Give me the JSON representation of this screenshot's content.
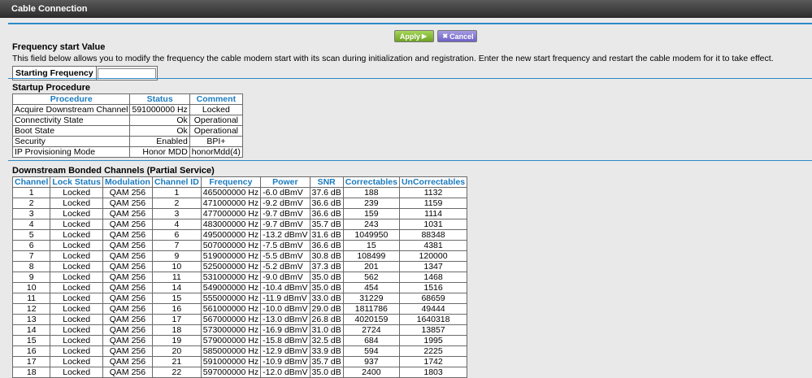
{
  "window": {
    "title": "Cable Connection"
  },
  "buttons": {
    "apply": "Apply",
    "cancel": "Cancel"
  },
  "frequency": {
    "title": "Frequency start Value",
    "description": "This field below allows you to modify the frequency the cable modem start with its scan during initialization and registration. Enter the new start frequency and restart the cable modem for it to take effect.",
    "label": "Starting Frequency",
    "value": ""
  },
  "startup": {
    "title": "Startup Procedure",
    "headers": [
      "Procedure",
      "Status",
      "Comment"
    ],
    "rows": [
      [
        "Acquire Downstream Channel",
        "591000000 Hz",
        "Locked"
      ],
      [
        "Connectivity State",
        "Ok",
        "Operational"
      ],
      [
        "Boot State",
        "Ok",
        "Operational"
      ],
      [
        "Security",
        "Enabled",
        "BPI+"
      ],
      [
        "IP Provisioning Mode",
        "Honor MDD",
        "honorMdd(4)"
      ]
    ]
  },
  "downstream": {
    "title": "Downstream Bonded Channels (Partial Service)",
    "headers": [
      "Channel",
      "Lock Status",
      "Modulation",
      "Channel ID",
      "Frequency",
      "Power",
      "SNR",
      "Correctables",
      "UnCorrectables"
    ],
    "rows": [
      [
        "1",
        "Locked",
        "QAM 256",
        "1",
        "465000000 Hz",
        "-6.0 dBmV",
        "37.6 dB",
        "188",
        "1132"
      ],
      [
        "2",
        "Locked",
        "QAM 256",
        "2",
        "471000000 Hz",
        "-9.2 dBmV",
        "36.6 dB",
        "239",
        "1159"
      ],
      [
        "3",
        "Locked",
        "QAM 256",
        "3",
        "477000000 Hz",
        "-9.7 dBmV",
        "36.6 dB",
        "159",
        "1114"
      ],
      [
        "4",
        "Locked",
        "QAM 256",
        "4",
        "483000000 Hz",
        "-9.7 dBmV",
        "35.7 dB",
        "243",
        "1031"
      ],
      [
        "5",
        "Locked",
        "QAM 256",
        "6",
        "495000000 Hz",
        "-13.2 dBmV",
        "31.6 dB",
        "1049950",
        "88348"
      ],
      [
        "6",
        "Locked",
        "QAM 256",
        "7",
        "507000000 Hz",
        "-7.5 dBmV",
        "36.6 dB",
        "15",
        "4381"
      ],
      [
        "7",
        "Locked",
        "QAM 256",
        "9",
        "519000000 Hz",
        "-5.5 dBmV",
        "30.8 dB",
        "108499",
        "120000"
      ],
      [
        "8",
        "Locked",
        "QAM 256",
        "10",
        "525000000 Hz",
        "-5.2 dBmV",
        "37.3 dB",
        "201",
        "1347"
      ],
      [
        "9",
        "Locked",
        "QAM 256",
        "11",
        "531000000 Hz",
        "-9.0 dBmV",
        "35.0 dB",
        "562",
        "1468"
      ],
      [
        "10",
        "Locked",
        "QAM 256",
        "14",
        "549000000 Hz",
        "-10.4 dBmV",
        "35.0 dB",
        "454",
        "1516"
      ],
      [
        "11",
        "Locked",
        "QAM 256",
        "15",
        "555000000 Hz",
        "-11.9 dBmV",
        "33.0 dB",
        "31229",
        "68659"
      ],
      [
        "12",
        "Locked",
        "QAM 256",
        "16",
        "561000000 Hz",
        "-10.0 dBmV",
        "29.0 dB",
        "1811786",
        "49444"
      ],
      [
        "13",
        "Locked",
        "QAM 256",
        "17",
        "567000000 Hz",
        "-13.0 dBmV",
        "26.8 dB",
        "4020159",
        "1640318"
      ],
      [
        "14",
        "Locked",
        "QAM 256",
        "18",
        "573000000 Hz",
        "-16.9 dBmV",
        "31.0 dB",
        "2724",
        "13857"
      ],
      [
        "15",
        "Locked",
        "QAM 256",
        "19",
        "579000000 Hz",
        "-15.8 dBmV",
        "32.5 dB",
        "684",
        "1995"
      ],
      [
        "16",
        "Locked",
        "QAM 256",
        "20",
        "585000000 Hz",
        "-12.9 dBmV",
        "33.9 dB",
        "594",
        "2225"
      ],
      [
        "17",
        "Locked",
        "QAM 256",
        "21",
        "591000000 Hz",
        "-10.9 dBmV",
        "35.7 dB",
        "937",
        "1742"
      ],
      [
        "18",
        "Locked",
        "QAM 256",
        "22",
        "597000000 Hz",
        "-12.0 dBmV",
        "35.0 dB",
        "2400",
        "1803"
      ]
    ]
  }
}
